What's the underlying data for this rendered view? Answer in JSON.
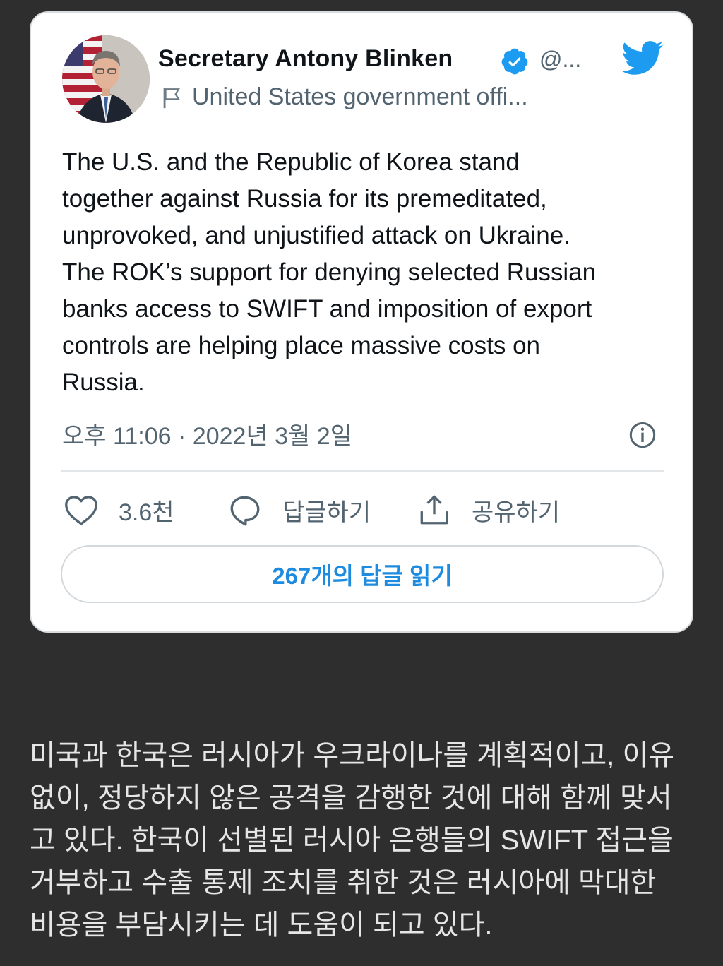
{
  "tweet": {
    "author_name": "Secretary Antony Blinken",
    "handle": "@...",
    "affiliation": "United States government offi...",
    "text_lines": [
      "The U.S. and the Republic of Korea stand",
      "together against Russia for its premeditated,",
      "unprovoked, and unjustified attack on Ukraine.",
      "The ROK’s support for denying selected Russian",
      "banks access to SWIFT and imposition of export",
      "controls are helping place massive costs on",
      "Russia."
    ],
    "timestamp": "오후 11:06 · 2022년 3월 2일",
    "actions": {
      "like_count": "3.6천",
      "reply_label": "답글하기",
      "share_label": "공유하기"
    },
    "read_replies_label": "267개의 답글 읽기"
  },
  "translation_lines": [
    "미국과 한국은 러시아가 우크라이나를 계획적이고, 이유",
    "없이, 정당하지 않은 공격을 감행한 것에 대해 함께 맞서",
    "고 있다. 한국이 선별된 러시아 은행들의 SWIFT 접근을",
    "거부하고 수출 통제 조치를 취한 것은 러시아에 막대한",
    "비용을 부담시키는 데 도움이 되고 있다."
  ],
  "icons": {
    "verified": "verified-badge-icon",
    "flag": "flag-icon",
    "brand": "twitter-bird-icon",
    "info": "info-icon",
    "like": "heart-icon",
    "reply": "speech-bubble-icon",
    "share": "share-upload-icon"
  },
  "colors": {
    "page_background": "#2e2e2e",
    "card_background": "#ffffff",
    "twitter_blue": "#1d9bf0",
    "link_blue": "#1d8ce0",
    "muted_text": "#536471",
    "body_text": "#0f1419",
    "translation_text": "#e6e6e6"
  }
}
